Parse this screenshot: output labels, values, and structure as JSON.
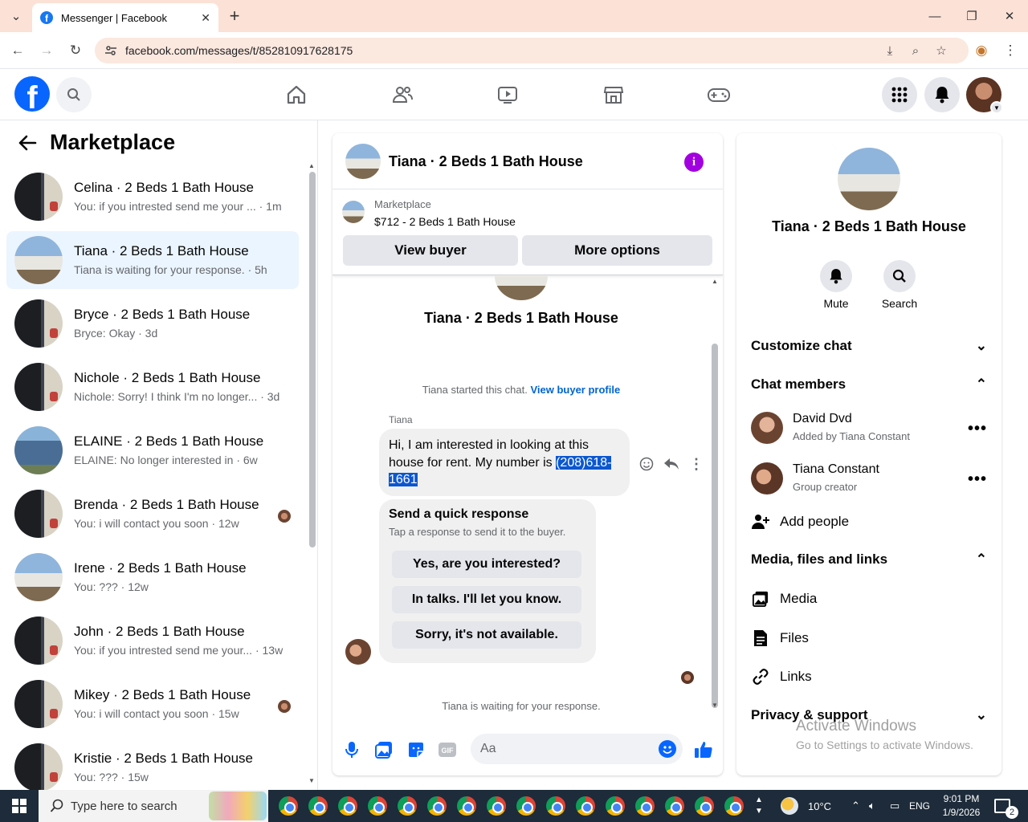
{
  "browser": {
    "tab_title": "Messenger | Facebook",
    "url": "facebook.com/messages/t/852810917628175"
  },
  "left": {
    "title": "Marketplace",
    "conversations": [
      {
        "name": "Celina · 2 Beds 1 Bath House",
        "preview": "You: if you intrested send me your ... · 1m",
        "pic": "dark"
      },
      {
        "name": "Tiana · 2 Beds 1 Bath House",
        "preview": "Tiana is waiting for your response. · 5h",
        "pic": "house",
        "active": true
      },
      {
        "name": "Bryce · 2 Beds 1 Bath House",
        "preview": "Bryce: Okay · 3d",
        "pic": "dark"
      },
      {
        "name": "Nichole · 2 Beds 1 Bath House",
        "preview": "Nichole: Sorry! I think I'm no longer... · 3d",
        "pic": "dark"
      },
      {
        "name": "ELAINE · 2 Beds 1 Bath House",
        "preview": "ELAINE: No longer interested in · 6w",
        "pic": "blue"
      },
      {
        "name": "Brenda · 2 Beds 1 Bath House",
        "preview": "You: i will contact you soon · 12w",
        "pic": "dark",
        "seen": true
      },
      {
        "name": "Irene · 2 Beds 1 Bath House",
        "preview": "You: ??? · 12w",
        "pic": "house"
      },
      {
        "name": "John · 2 Beds 1 Bath House",
        "preview": "You: if you intrested send me your... · 13w",
        "pic": "dark"
      },
      {
        "name": "Mikey · 2 Beds 1 Bath House",
        "preview": "You: i will contact you soon · 15w",
        "pic": "dark",
        "seen": true
      },
      {
        "name": "Kristie · 2 Beds 1 Bath House",
        "preview": "You: ??? · 15w",
        "pic": "dark"
      }
    ]
  },
  "chat": {
    "title": "Tiana · 2 Beds 1 Bath House",
    "marketplace_label": "Marketplace",
    "listing": "$712 - 2 Beds 1 Bath House",
    "view_buyer": "View buyer",
    "more_options": "More options",
    "contact_name": "Tiana · 2 Beds 1 Bath House",
    "started_text": "Tiana started this chat.",
    "view_buyer_profile": "View buyer profile",
    "sender": "Tiana",
    "message_text": "Hi, I am interested in looking at this house for rent. My number is ",
    "message_phone_1": "(208)618-",
    "message_phone_2": "1661",
    "quick_title": "Send a quick response",
    "quick_sub": "Tap a response to send it to the buyer.",
    "quick_replies": [
      "Yes, are you interested?",
      "In talks. I'll let you know.",
      "Sorry, it's not available."
    ],
    "waiting": "Tiana is waiting for your response.",
    "input_placeholder": "Aa"
  },
  "right": {
    "name": "Tiana · 2 Beds 1 Bath House",
    "mute": "Mute",
    "search": "Search",
    "customize": "Customize chat",
    "members_title": "Chat members",
    "members": [
      {
        "name": "David Dvd",
        "sub": "Added by Tiana Constant"
      },
      {
        "name": "Tiana Constant",
        "sub": "Group creator"
      }
    ],
    "add_people": "Add people",
    "media_title": "Media, files and links",
    "media": "Media",
    "files": "Files",
    "links": "Links",
    "privacy": "Privacy & support"
  },
  "watermark": {
    "line1": "Activate Windows",
    "line2": "Go to Settings to activate Windows."
  },
  "taskbar": {
    "search_placeholder": "Type here to search",
    "weather": "10°C",
    "lang": "ENG",
    "time": "9:01 PM",
    "date": "1/9/2026",
    "notif_count": "2"
  },
  "colors": {
    "fb_blue": "#0866ff",
    "active_row": "#ebf5ff",
    "info_purple": "#a200e0"
  }
}
